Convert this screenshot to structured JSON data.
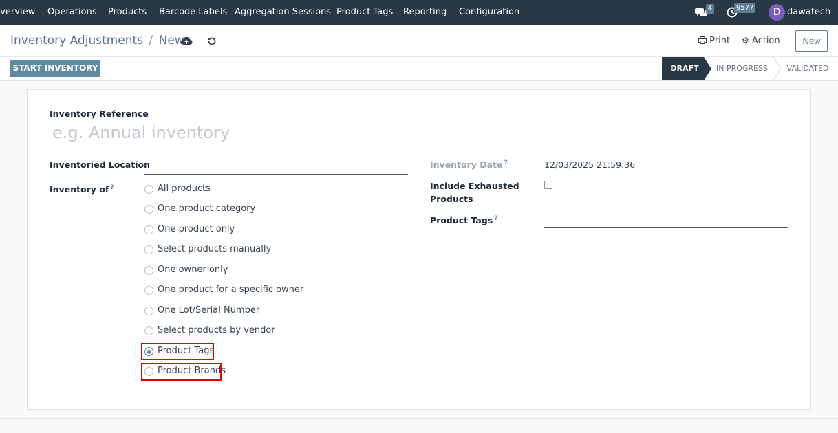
{
  "nav": {
    "items": [
      "Overview",
      "Operations",
      "Products",
      "Barcode Labels",
      "Aggregation Sessions",
      "Product Tags",
      "Reporting",
      "Configuration"
    ],
    "messages_count": "4",
    "activities_count": "9577",
    "user_initial": "D",
    "user_name": "dawatech__"
  },
  "control": {
    "breadcrumb_parent": "Inventory Adjustments",
    "breadcrumb_separator": "/",
    "breadcrumb_current": "New",
    "print_label": "Print",
    "action_label": "Action",
    "new_label": "New"
  },
  "statusbar": {
    "start_label": "START INVENTORY",
    "stages": [
      "DRAFT",
      "IN PROGRESS",
      "VALIDATED"
    ],
    "active_stage": "DRAFT"
  },
  "form": {
    "reference_label": "Inventory Reference",
    "reference_placeholder": "e.g. Annual inventory",
    "location_label": "Inventoried Location",
    "inventory_of_label": "Inventory of",
    "help_mark": "?",
    "options": [
      "All products",
      "One product category",
      "One product only",
      "Select products manually",
      "One owner only",
      "One product for a specific owner",
      "One Lot/Serial Number",
      "Select products by vendor",
      "Product Tags",
      "Product Brands"
    ],
    "selected_option": "Product Tags",
    "inventory_date_label": "Inventory Date",
    "inventory_date_value": "12/03/2025 21:59:36",
    "include_exhausted_label_1": "Include Exhausted",
    "include_exhausted_label_2": "Products",
    "include_exhausted_checked": false,
    "product_tags_label": "Product Tags"
  },
  "colors": {
    "navbar": "#283845",
    "accent": "#5f8aa2",
    "highlight": "#e10000",
    "active_stage": "#283845"
  }
}
